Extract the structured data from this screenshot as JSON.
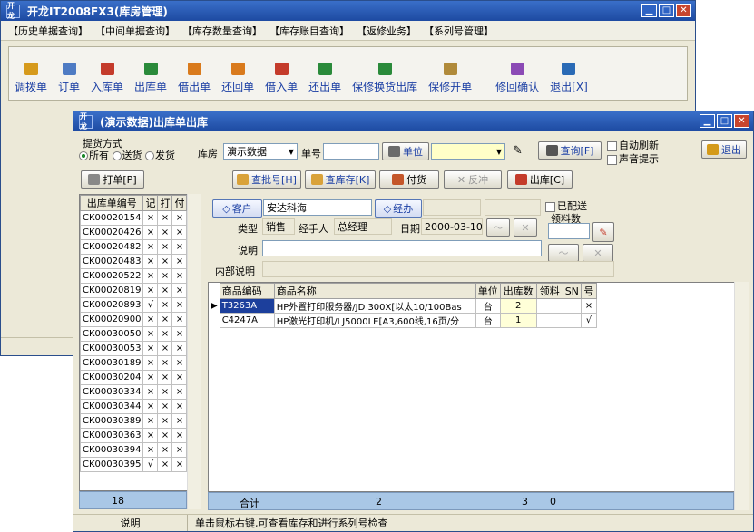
{
  "main_window": {
    "title": "开龙IT2008FX3(库房管理)",
    "logo": "开龙",
    "menu": [
      "【历史单据查询】",
      "【中间单据查询】",
      "【库存数量查询】",
      "【库存账目查询】",
      "【返修业务】",
      "【系列号管理】"
    ],
    "toolbar": [
      {
        "label": "调拨单",
        "icon": "transfer-icon",
        "color": "#d69a1c"
      },
      {
        "label": "订单",
        "icon": "document-icon",
        "color": "#4e7bc3"
      },
      {
        "label": "入库单",
        "icon": "truck-in-icon",
        "color": "#c43b2b"
      },
      {
        "label": "出库单",
        "icon": "truck-out-icon",
        "color": "#2a8a3a"
      },
      {
        "label": "借出单",
        "icon": "lend-out-icon",
        "color": "#d97a1c"
      },
      {
        "label": "还回单",
        "icon": "return-icon",
        "color": "#d97a1c"
      },
      {
        "label": "借入单",
        "icon": "borrow-in-icon",
        "color": "#c43b2b"
      },
      {
        "label": "还出单",
        "icon": "return-out-icon",
        "color": "#2a8a3a"
      },
      {
        "label": "保修换货出库",
        "icon": "exchange-icon",
        "color": "#2a8a3a"
      },
      {
        "label": "保修开单",
        "icon": "repair-icon",
        "color": "#b08a3a"
      },
      {
        "label": "修回确认",
        "icon": "confirm-icon",
        "color": "#8b4ab5"
      },
      {
        "label": "退出[X]",
        "icon": "exit-icon",
        "color": "#2a6ab5"
      }
    ]
  },
  "dialog": {
    "title": "(演示数据)出库单出库",
    "logo": "开龙",
    "delivery_label": "提货方式",
    "delivery_options": [
      "所有",
      "送货",
      "发货"
    ],
    "warehouse_label": "库房",
    "warehouse_value": "演示数据",
    "doc_no_label": "单号",
    "unit_button": "单位",
    "query_button": "查询[F]",
    "auto_refresh": "自动刷新",
    "sound_prompt": "声音提示",
    "exit_button": "退出",
    "print_button": "打单[P]",
    "batch_query_button": "查批号[H]",
    "stock_query_button": "查库存[K]",
    "payment_button": "付货",
    "reverse_button": "反冲",
    "outbound_button": "出库[C]",
    "list_headers": [
      "出库单编号",
      "记",
      "打",
      "付"
    ],
    "list_rows": [
      [
        "CK00020154",
        "×",
        "×",
        "×"
      ],
      [
        "CK00020426",
        "×",
        "×",
        "×"
      ],
      [
        "CK00020482",
        "×",
        "×",
        "×"
      ],
      [
        "CK00020483",
        "×",
        "×",
        "×"
      ],
      [
        "CK00020522",
        "×",
        "×",
        "×"
      ],
      [
        "CK00020819",
        "×",
        "×",
        "×"
      ],
      [
        "CK00020893",
        "√",
        "×",
        "×"
      ],
      [
        "CK00020900",
        "×",
        "×",
        "×"
      ],
      [
        "CK00030050",
        "×",
        "×",
        "×"
      ],
      [
        "CK00030053",
        "×",
        "×",
        "×"
      ],
      [
        "CK00030189",
        "×",
        "×",
        "×"
      ],
      [
        "CK00030204",
        "×",
        "×",
        "×"
      ],
      [
        "CK00030334",
        "×",
        "×",
        "×"
      ],
      [
        "CK00030344",
        "×",
        "×",
        "×"
      ],
      [
        "CK00030389",
        "×",
        "×",
        "×"
      ],
      [
        "CK00030363",
        "×",
        "×",
        "×"
      ],
      [
        "CK00030394",
        "×",
        "×",
        "×"
      ],
      [
        "CK00030395",
        "√",
        "×",
        "×"
      ]
    ],
    "list_count": "18",
    "customer_button": "客户",
    "customer_value": "安达科海",
    "handler_button": "经办",
    "delivered_label": "已配送",
    "material_count_label": "领料数",
    "type_label": "类型",
    "type_value": "销售",
    "agent_label": "经手人",
    "agent_value": "总经理",
    "date_label": "日期",
    "date_value": "2000-03-10",
    "note_label": "说明",
    "internal_note_label": "内部说明",
    "item_headers": [
      "商品编码",
      "商品名称",
      "单位",
      "出库数",
      "领料",
      "SN",
      "号"
    ],
    "items": [
      [
        "T3263A",
        "HP外置打印服务器/JD 300X[以太10/100Bas",
        "台",
        "2",
        "",
        "",
        "×"
      ],
      [
        "C4247A",
        "HP激光打印机/LJ5000LE[A3,600线,16页/分",
        "台",
        "1",
        "",
        "",
        "√"
      ]
    ],
    "total_label": "合计",
    "total_lines": "2",
    "total_qty": "3",
    "total_material": "0",
    "status_label": "说明",
    "status_text": "单击鼠标右键,可查看库存和进行系列号检查"
  }
}
